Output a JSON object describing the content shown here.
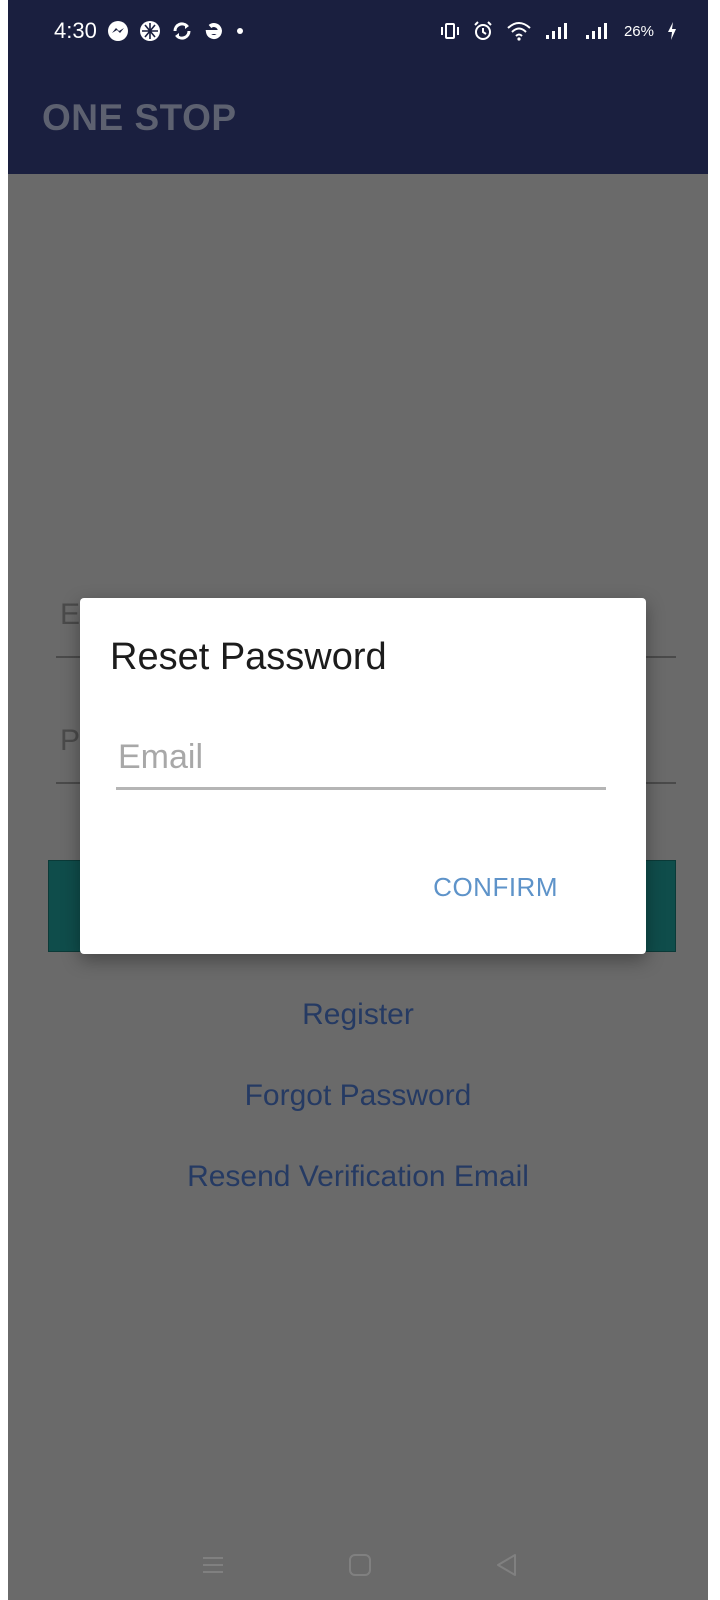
{
  "status_bar": {
    "time": "4:30",
    "battery": "26%",
    "icons_left": [
      "messenger-icon",
      "dribbble-icon",
      "sync-icon",
      "e-app-icon",
      "dot-icon"
    ],
    "icons_right": [
      "vibrate-icon",
      "alarm-icon",
      "wifi-icon",
      "signal-icon",
      "signal-icon",
      "battery-charging-icon"
    ]
  },
  "app_bar": {
    "title": "ONE STOP"
  },
  "login_form": {
    "email_placeholder_letter": "E",
    "password_placeholder_letter": "P"
  },
  "links": {
    "register": "Register",
    "forgot_password": "Forgot Password",
    "resend_verification": "Resend Verification Email"
  },
  "dialog": {
    "title": "Reset Password",
    "email_placeholder": "Email",
    "email_value": "",
    "confirm_label": "CONFIRM"
  },
  "nav_bar": {
    "icons": [
      "menu-icon",
      "home-icon",
      "back-icon"
    ]
  },
  "colors": {
    "app_bar": "#1a1f3f",
    "scrim_background": "#6a6a6a",
    "login_button": "#0f4d4b",
    "link_text": "#253a63",
    "dialog_accent": "#5e93c9"
  }
}
